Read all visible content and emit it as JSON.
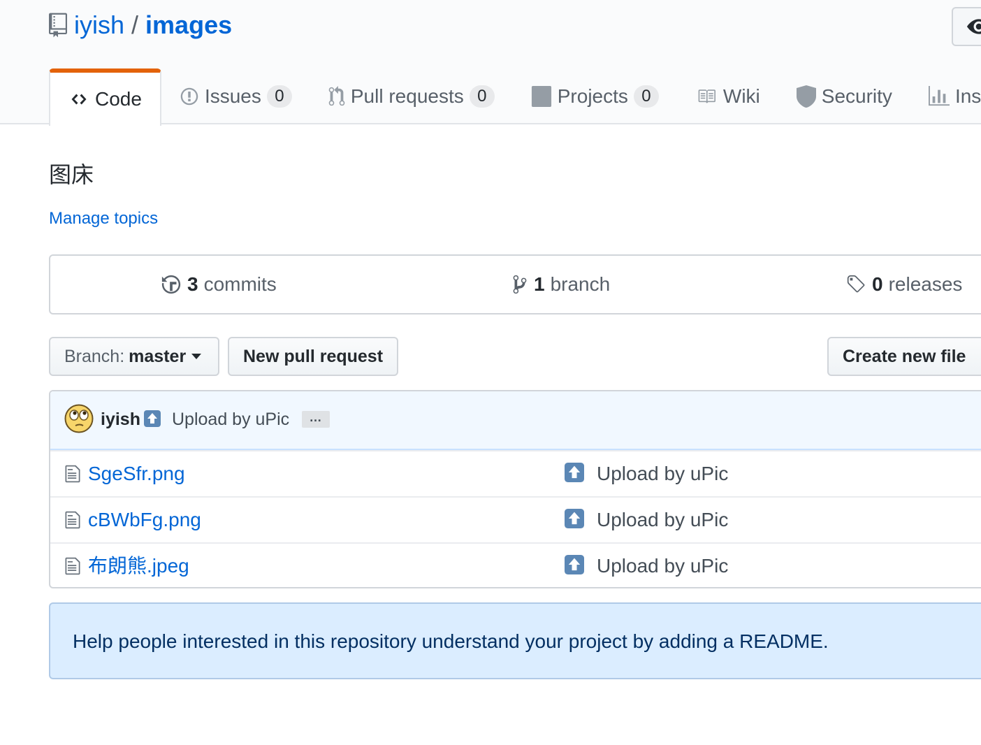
{
  "repo": {
    "owner": "iyish",
    "separator": "/",
    "name": "images"
  },
  "tabs": [
    {
      "label": "Code",
      "icon": "code-icon"
    },
    {
      "label": "Issues",
      "count": "0",
      "icon": "issue-opened-icon"
    },
    {
      "label": "Pull requests",
      "count": "0",
      "icon": "git-pull-request-icon"
    },
    {
      "label": "Projects",
      "count": "0",
      "icon": "project-icon"
    },
    {
      "label": "Wiki",
      "icon": "book-icon"
    },
    {
      "label": "Security",
      "icon": "shield-icon"
    },
    {
      "label": "Ins",
      "icon": "graph-icon"
    }
  ],
  "description": "图床",
  "manage_topics": "Manage topics",
  "summary": {
    "commits_num": "3",
    "commits_label": "commits",
    "branch_num": "1",
    "branch_label": "branch",
    "releases_num": "0",
    "releases_label": "releases"
  },
  "file_nav": {
    "branch_prefix": "Branch:",
    "branch_name": "master",
    "new_pull_request": "New pull request",
    "create_new_file": "Create new file"
  },
  "commit_tease": {
    "author": "iyish",
    "message": "Upload by uPic",
    "ellipsis": "…"
  },
  "files": [
    {
      "name": "SgeSfr.png",
      "message": "Upload by uPic"
    },
    {
      "name": "cBWbFg.png",
      "message": "Upload by uPic"
    },
    {
      "name": "布朗熊.jpeg",
      "message": "Upload by uPic"
    }
  ],
  "readme_prompt": "Help people interested in this repository understand your project by adding a README.",
  "colors": {
    "link": "#0366d6",
    "tab_accent": "#e36209",
    "readme_bg": "#dbedff",
    "commit_bg": "#f1f8ff"
  }
}
